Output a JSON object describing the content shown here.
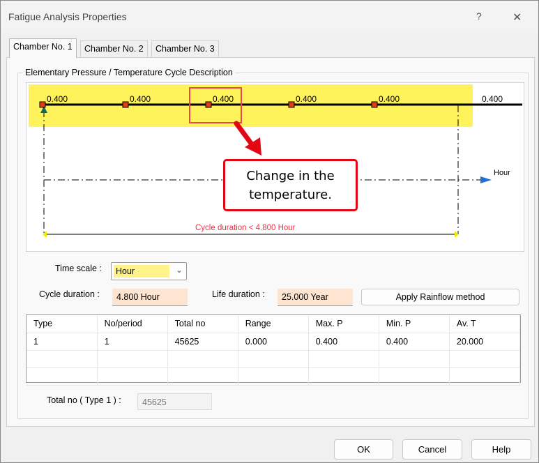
{
  "window": {
    "title": "Fatigue Analysis Properties",
    "help_glyph": "?",
    "close_glyph": "✕"
  },
  "tabs": [
    {
      "label": "Chamber No. 1",
      "active": true
    },
    {
      "label": "Chamber No. 2"
    },
    {
      "label": "Chamber No. 3"
    }
  ],
  "group": {
    "title": "Elementary Pressure / Temperature Cycle Description"
  },
  "diagram": {
    "point_labels": [
      "0.400",
      "0.400",
      "0.400",
      "0.400",
      "0.400",
      "0.400"
    ],
    "axis_unit": "Hour",
    "cycle_label": "Cycle duration < 4.800 Hour",
    "highlight_color": "#fff35c"
  },
  "callout": {
    "text": "Change in the temperature.",
    "color": "#e30613"
  },
  "controls": {
    "time_scale_label": "Time scale :",
    "time_scale_value": "Hour",
    "cycle_duration_label": "Cycle duration :",
    "cycle_duration_value": "4.800 Hour",
    "life_duration_label": "Life duration :",
    "life_duration_value": "25.000 Year",
    "rainflow_button": "Apply Rainflow method"
  },
  "table": {
    "headers": [
      "Type",
      "No/period",
      "Total no",
      "Range",
      "Max. P",
      "Min. P",
      "Av. T"
    ],
    "rows": [
      [
        "1",
        "1",
        "45625",
        "0.000",
        "0.400",
        "0.400",
        "20.000"
      ]
    ]
  },
  "total": {
    "label": "Total no ( Type 1 ) :",
    "value": "45625"
  },
  "footer": {
    "ok": "OK",
    "cancel": "Cancel",
    "help": "Help"
  }
}
